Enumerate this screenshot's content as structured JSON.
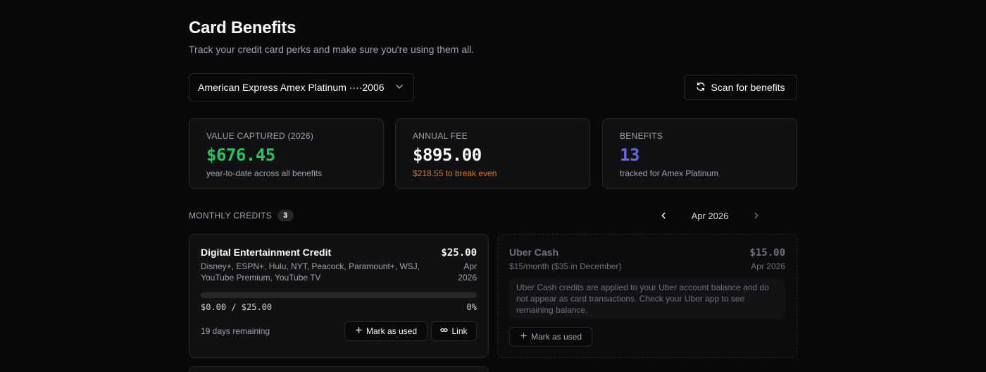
{
  "header": {
    "title": "Card Benefits",
    "subtitle": "Track your credit card perks and make sure you're using them all."
  },
  "card_select": {
    "value": "American Express Amex Platinum ····2006",
    "icon": "chevron-down-icon"
  },
  "scan_button": {
    "label": "Scan for benefits",
    "icon": "refresh-icon"
  },
  "stats": [
    {
      "label": "VALUE CAPTURED (2026)",
      "value": "$676.45",
      "sub": "year-to-date across all benefits",
      "color": "#22c55e"
    },
    {
      "label": "ANNUAL FEE",
      "value": "$895.00",
      "sub": "$218.55 to break even",
      "color": "#fafafa",
      "sub_color": "#f59e0b"
    },
    {
      "label": "BENEFITS",
      "value": "13",
      "sub": "tracked for Amex Platinum",
      "color": "#6366f1"
    }
  ],
  "monthly": {
    "label": "MONTHLY CREDITS",
    "count": "3",
    "month": "Apr 2026"
  },
  "credits": [
    {
      "name": "Digital Entertainment Credit",
      "description": "Disney+, ESPN+, Hulu, NYT, Peacock, Paramount+, WSJ, YouTube Premium, YouTube TV",
      "amount": "$25.00",
      "period": "Apr 2026",
      "progress_text": "$0.00 / $25.00",
      "progress_percent": "0%",
      "progress_fraction": 0,
      "days_remaining": "19 days remaining",
      "mark_label": "Mark as used",
      "link_label": "Link"
    },
    {
      "name": "Uber Cash",
      "description": "$15/month ($35 in December)",
      "amount": "$15.00",
      "period": "Apr 2026",
      "note": "Uber Cash credits are applied to your Uber account balance and do not appear as card transactions. Check your Uber app to see remaining balance.",
      "mark_label": "Mark as used"
    }
  ]
}
